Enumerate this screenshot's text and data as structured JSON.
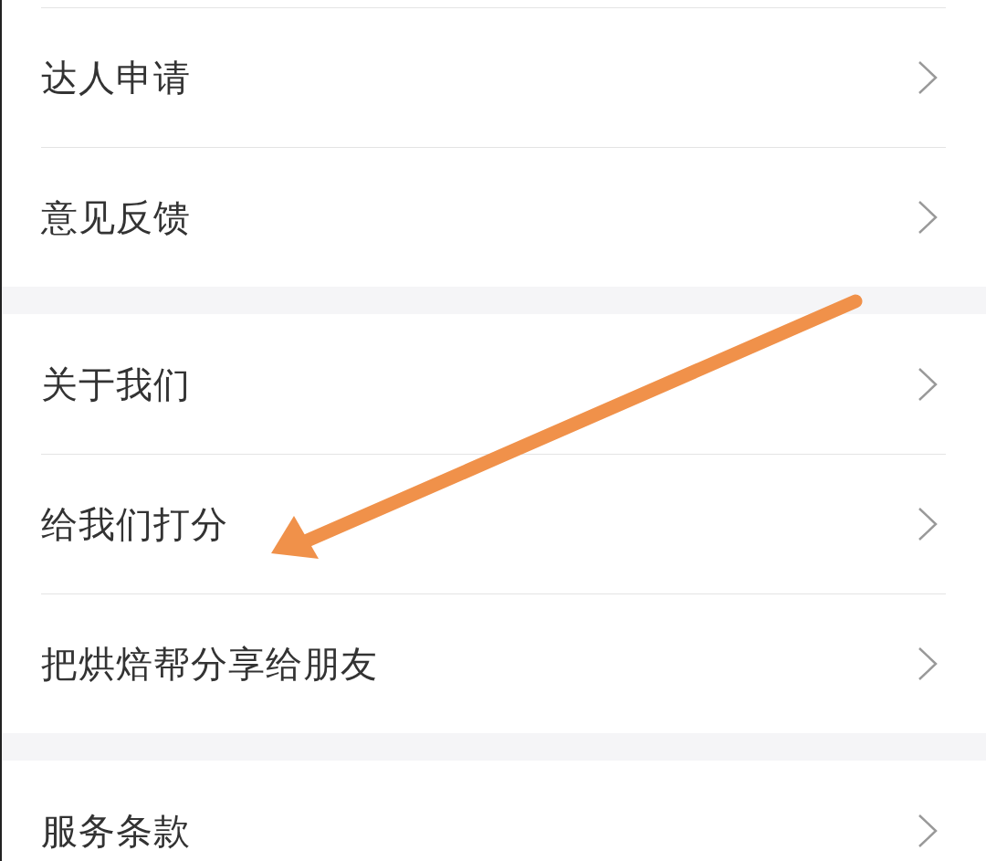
{
  "sections": [
    {
      "items": [
        {
          "label": "达人申请"
        },
        {
          "label": "意见反馈"
        }
      ]
    },
    {
      "items": [
        {
          "label": "关于我们"
        },
        {
          "label": "给我们打分"
        },
        {
          "label": "把烘焙帮分享给朋友"
        }
      ]
    },
    {
      "items": [
        {
          "label": "服务条款"
        }
      ]
    }
  ]
}
